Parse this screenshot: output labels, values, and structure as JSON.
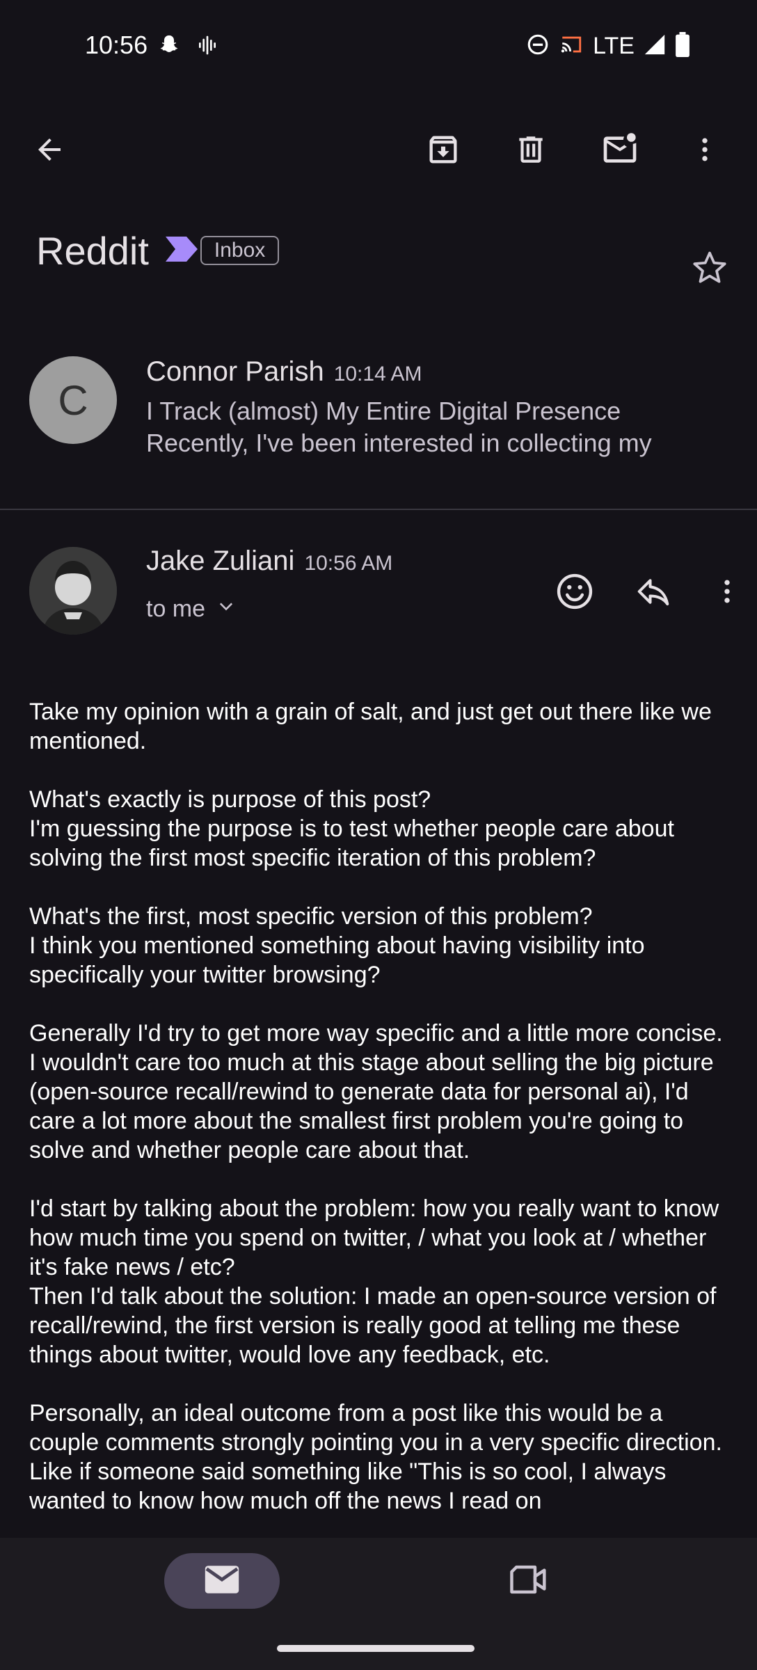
{
  "status_bar": {
    "time": "10:56",
    "network": "LTE",
    "icons": [
      "snapchat-icon",
      "voicemail-icon",
      "do-not-disturb-icon",
      "cast-icon",
      "signal-icon",
      "battery-icon"
    ]
  },
  "toolbar": {
    "icons": [
      "back-arrow-icon",
      "archive-icon",
      "delete-icon",
      "mark-unread-icon",
      "more-vert-icon"
    ]
  },
  "subject": {
    "title": "Reddit",
    "label": "Inbox"
  },
  "collapsed_message": {
    "avatar_letter": "C",
    "sender": "Connor Parish",
    "time": "10:14 AM",
    "snippet_line1": "I Track (almost) My Entire Digital Presence",
    "snippet_line2": "Recently, I've been interested in collecting my"
  },
  "open_message": {
    "sender": "Jake Zuliani",
    "time": "10:56 AM",
    "recipient": "to me",
    "paragraphs": [
      "Take my opinion with a grain of salt, and just get out there like we mentioned.",
      "What's exactly is purpose of this post?\nI'm guessing the purpose is to test whether people care about solving the first most specific iteration of this problem?",
      "What's the first, most specific version of this problem?\nI think you mentioned something about having visibility into specifically your twitter browsing?",
      "Generally I'd try to get more way specific and a little more concise. I wouldn't care too much at this stage about selling the big picture (open-source recall/rewind to generate data for personal ai), I'd care a lot more about the smallest first problem you're going to solve and whether people care about that.",
      "I'd start by talking about the problem: how you really want to know how much time you spend on twitter, / what you look at / whether it's fake news / etc?\nThen I'd talk about the solution: I made an open-source version of recall/rewind, the first version is really good at telling me these things about twitter, would love any feedback, etc.",
      "Personally, an ideal outcome from a post like this would be a couple comments strongly pointing you in a very specific direction. Like if someone said something like \"This is so cool, I always wanted to know how much off the news I read on"
    ]
  },
  "bottom_nav": {
    "items": [
      "mail-icon",
      "video-camera-icon"
    ],
    "selected": "mail-icon"
  }
}
